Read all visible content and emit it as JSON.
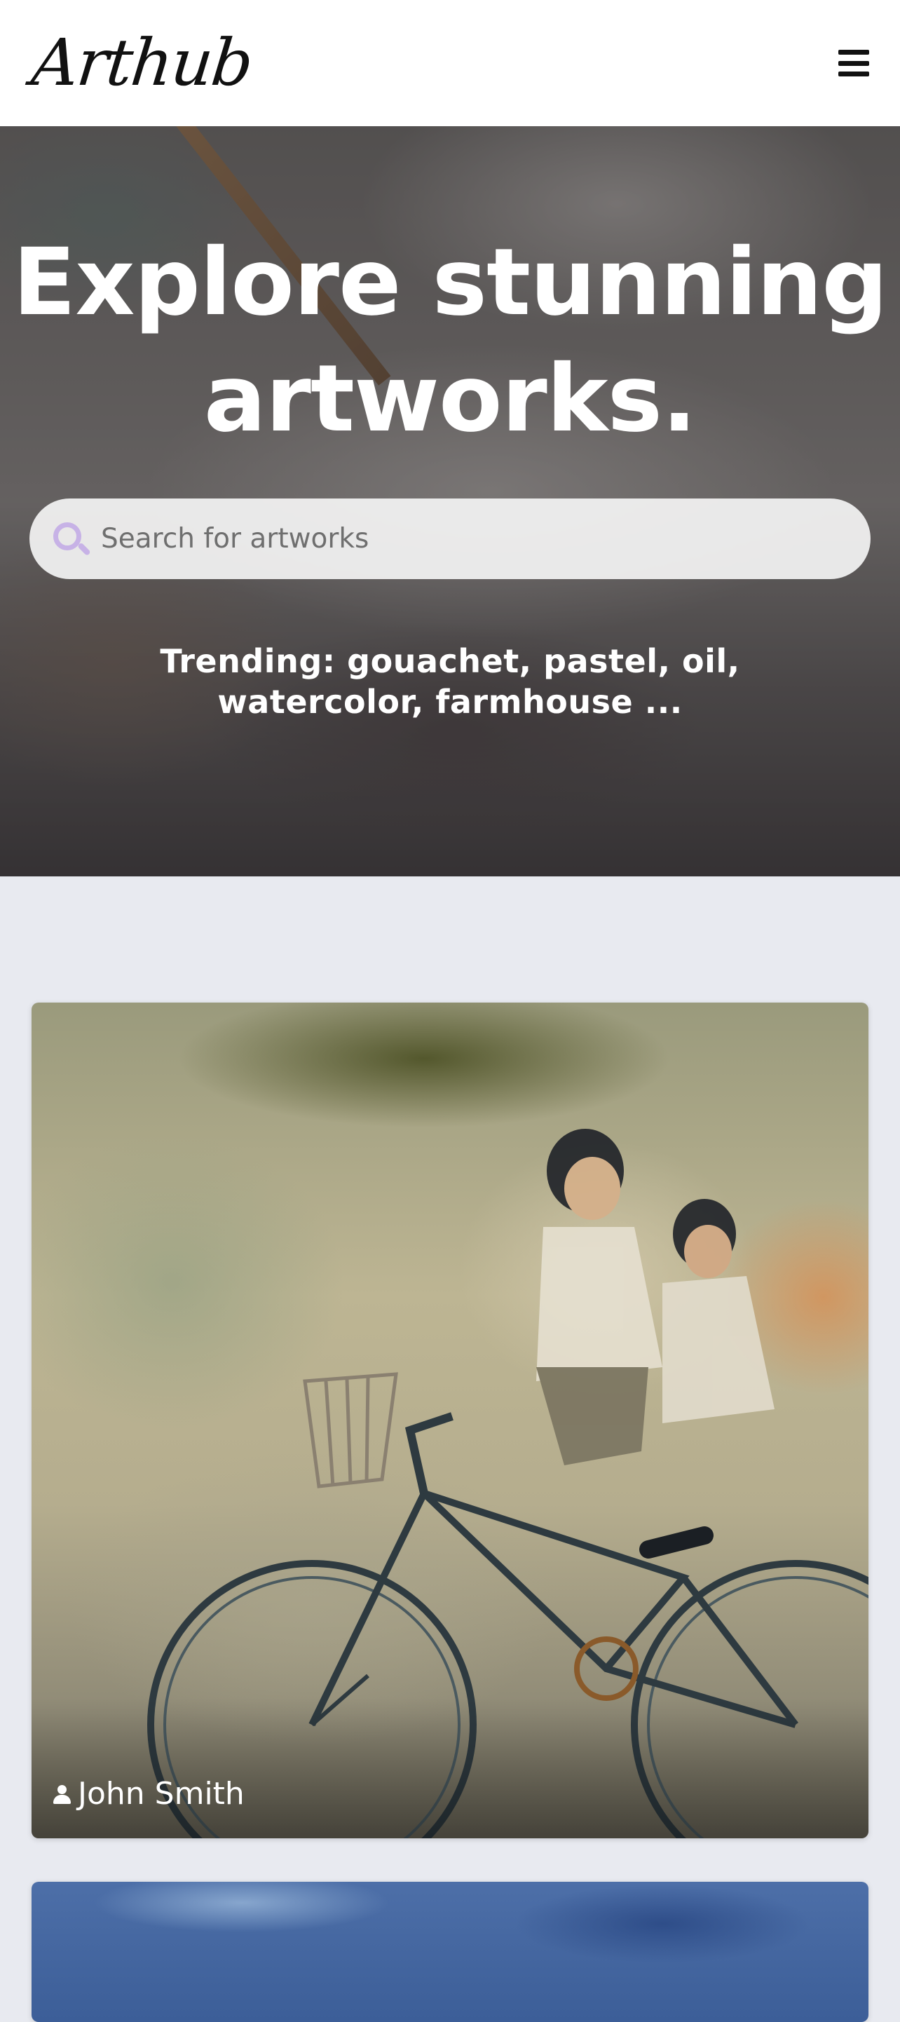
{
  "header": {
    "logo_text": "Arthub",
    "menu_icon": "hamburger-menu-icon"
  },
  "hero": {
    "title": "Explore stunning artworks.",
    "search": {
      "placeholder": "Search for artworks",
      "value": "",
      "icon": "search-icon",
      "icon_color": "#c7b2e6"
    },
    "trending": "Trending: gouachet, pastel, oil, watercolor, farmhouse ..."
  },
  "artworks": [
    {
      "artist": "John Smith",
      "icon": "user-icon"
    },
    {
      "artist": ""
    }
  ],
  "colors": {
    "page_background": "#e8eaf0",
    "header_background": "#ffffff",
    "hero_text": "#ffffff"
  }
}
